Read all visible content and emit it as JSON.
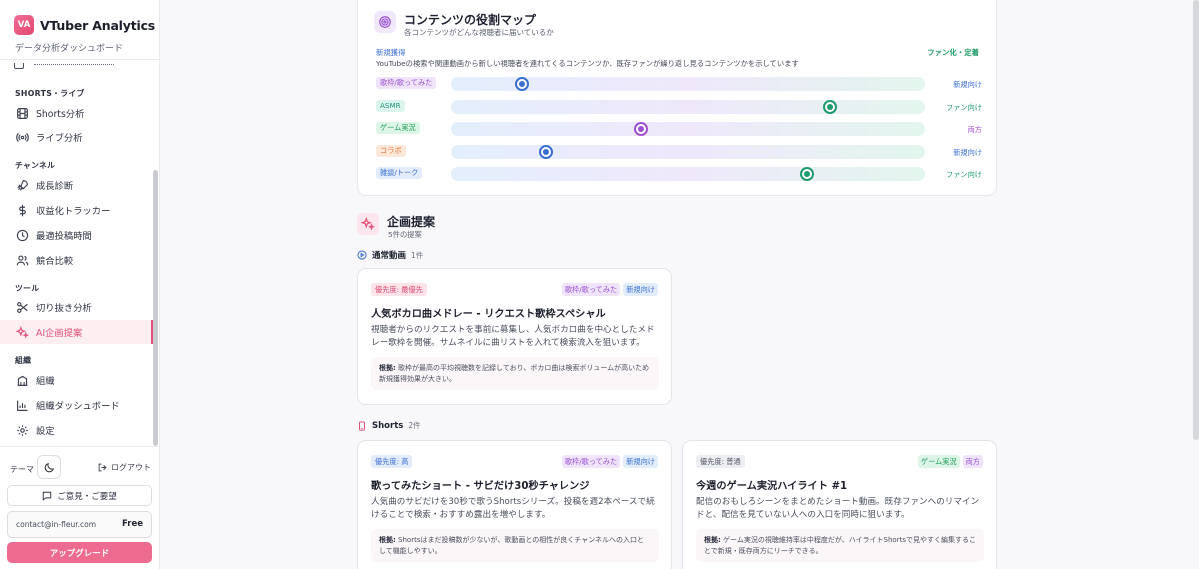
{
  "brand": {
    "logo": "VA",
    "name": "VTuber Analytics",
    "subtitle": "データ分析ダッシュボード"
  },
  "nav": {
    "sections": [
      {
        "label": "SHORTS・ライブ",
        "items": [
          {
            "label": "Shorts分析",
            "icon": "film-icon"
          },
          {
            "label": "ライブ分析",
            "icon": "broadcast-icon"
          }
        ]
      },
      {
        "label": "チャンネル",
        "items": [
          {
            "label": "成長診断",
            "icon": "rocket-icon"
          },
          {
            "label": "収益化トラッカー",
            "icon": "dollar-icon"
          },
          {
            "label": "最適投稿時間",
            "icon": "clock-icon"
          },
          {
            "label": "競合比較",
            "icon": "users-icon"
          }
        ]
      },
      {
        "label": "ツール",
        "items": [
          {
            "label": "切り抜き分析",
            "icon": "scissors-icon"
          },
          {
            "label": "AI企画提案",
            "icon": "sparkles-icon",
            "active": true
          }
        ]
      },
      {
        "label": "組織",
        "items": [
          {
            "label": "組織",
            "icon": "building-icon"
          },
          {
            "label": "組織ダッシュボード",
            "icon": "bar-chart-icon"
          },
          {
            "label": "設定",
            "icon": "gear-icon"
          }
        ]
      }
    ]
  },
  "sidebar_bottom": {
    "theme_label": "テーマ",
    "logout_label": "ログアウト",
    "feedback_label": "ご意見・ご要望",
    "email": "contact@in-fleur.com",
    "plan": "Free",
    "upgrade_label": "アップグレード"
  },
  "content_map": {
    "title": "コンテンツの役割マップ",
    "subtitle": "各コンテンツがどんな視聴者に届いているか",
    "legend_left": "新規獲得",
    "legend_right": "ファン化・定着",
    "description": "YouTubeの検索や関連動画から新しい視聴者を連れてくるコンテンツか、既存ファンが繰り返し見るコンテンツかを示しています",
    "rows": [
      {
        "label": "歌枠/歌ってみた",
        "position": 0.15,
        "result": "新規向け",
        "tag_class": "c-purple",
        "dot_color": "#3a6fd0",
        "result_color": "#3a6fd0"
      },
      {
        "label": "ASMR",
        "position": 0.8,
        "result": "ファン向け",
        "tag_class": "c-teal",
        "dot_color": "#1f9a6e",
        "result_color": "#1f9a6e"
      },
      {
        "label": "ゲーム実況",
        "position": 0.4,
        "result": "両方",
        "tag_class": "c-green",
        "dot_color": "#a04fd4",
        "result_color": "#a04fd4"
      },
      {
        "label": "コラボ",
        "position": 0.2,
        "result": "新規向け",
        "tag_class": "c-orange",
        "dot_color": "#3a6fd0",
        "result_color": "#3a6fd0"
      },
      {
        "label": "雑談/トーク",
        "position": 0.75,
        "result": "ファン向け",
        "tag_class": "c-blue",
        "dot_color": "#1f9a6e",
        "result_color": "#1f9a6e"
      }
    ]
  },
  "proposals": {
    "title": "企画提案",
    "count": "5件の提案",
    "groups": [
      {
        "label": "通常動画",
        "count": "1件"
      },
      {
        "label": "Shorts",
        "count": "2件"
      }
    ],
    "cards": [
      {
        "priority": "優先度: 最優先",
        "priority_class": "c-pink",
        "tags": [
          {
            "text": "歌枠/歌ってみた",
            "cls": "c-purple"
          },
          {
            "text": "新規向け",
            "cls": "c-blue"
          }
        ],
        "title": "人気ボカロ曲メドレー - リクエスト歌枠スペシャル",
        "description": "視聴者からのリクエストを事前に募集し、人気ボカロ曲を中心としたメドレー歌枠を開催。サムネイルに曲リストを入れて検索流入を狙います。",
        "basis_label": "根拠:",
        "basis": "歌枠が最高の平均視聴数を記録しており、ボカロ曲は検索ボリュームが高いため新規獲得効果が大きい。"
      },
      {
        "priority": "優先度: 高",
        "priority_class": "c-blue",
        "tags": [
          {
            "text": "歌枠/歌ってみた",
            "cls": "c-purple"
          },
          {
            "text": "新規向け",
            "cls": "c-blue"
          }
        ],
        "title": "歌ってみたショート - サビだけ30秒チャレンジ",
        "description": "人気曲のサビだけを30秒で歌うShortsシリーズ。投稿を週2本ペースで続けることで検索・おすすめ露出を増やします。",
        "basis_label": "根拠:",
        "basis": "Shortsはまだ投稿数が少ないが、歌動画との相性が良くチャンネルへの入口として機能しやすい。"
      },
      {
        "priority": "優先度: 普通",
        "priority_class": "c-gray",
        "tags": [
          {
            "text": "ゲーム実況",
            "cls": "c-green"
          },
          {
            "text": "両方",
            "cls": "c-purple"
          }
        ],
        "title": "今週のゲーム実況ハイライト #1",
        "description": "配信のおもしろシーンをまとめたショート動画。既存ファンへのリマインドと、配信を見ていない人への入口を同時に狙います。",
        "basis_label": "根拠:",
        "basis": "ゲーム実況の視聴維持率は中程度だが、ハイライトShortsで見やすく編集することで新規・既存両方にリーチできる。"
      }
    ]
  }
}
